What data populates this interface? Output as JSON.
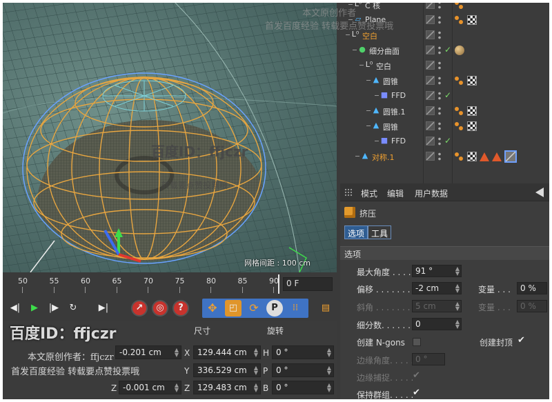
{
  "viewport": {
    "grid_readout": "网格间距 : 100 cm"
  },
  "objects": [
    {
      "name": "C 核",
      "color": "#dddddd",
      "tags": [
        "phong"
      ]
    },
    {
      "name": "Plane",
      "color": "#dddddd",
      "tags": [
        "phong",
        "checker"
      ]
    },
    {
      "name": "空白",
      "color": "#f0a030",
      "tags": []
    },
    {
      "name": "细分曲面",
      "color": "#dddddd",
      "tags": [
        "material"
      ],
      "check": "✓"
    },
    {
      "name": "空白",
      "color": "#dddddd",
      "tags": []
    },
    {
      "name": "圆锥",
      "color": "#dddddd",
      "tags": [
        "phong",
        "checker"
      ]
    },
    {
      "name": "FFD",
      "color": "#dddddd",
      "tags": [],
      "check": "✓"
    },
    {
      "name": "圆锥.1",
      "color": "#dddddd",
      "tags": [
        "phong",
        "checker"
      ]
    },
    {
      "name": "圆锥",
      "color": "#dddddd",
      "tags": [
        "phong",
        "checker"
      ]
    },
    {
      "name": "FFD",
      "color": "#dddddd",
      "tags": [],
      "check": "✓"
    },
    {
      "name": "对称.1",
      "color": "#f0a030",
      "tags": [
        "phong",
        "checker",
        "tri",
        "tri",
        "selected"
      ]
    }
  ],
  "attributes": {
    "menu": [
      "模式",
      "编辑",
      "用户数据"
    ],
    "object_name": "挤压",
    "tabs": [
      "选项",
      "工具"
    ],
    "section": "选项",
    "params": {
      "max_angle": {
        "label": "最大角度 . . . . . .",
        "value": "91 °"
      },
      "offset": {
        "label": "偏移 . . . . . . . .",
        "value": "-2 cm"
      },
      "bevel": {
        "label": "斜角 . . . . . . . .",
        "value": "5 cm"
      },
      "subdiv": {
        "label": "细分数. . . . . . .",
        "value": "0"
      },
      "create_ngons": {
        "label": "创建 N-gons"
      },
      "create_caps": {
        "label": "创建封顶"
      },
      "edge_angle": {
        "label": "边缘角度. . . . .",
        "value": "0 °"
      },
      "edge_snap": {
        "label": "边缘捕捉. . . . ."
      },
      "preserve_groups": {
        "label": "保持群组. . . . ."
      },
      "var1": {
        "label": "变量 . . .",
        "value": "0 %"
      },
      "var2": {
        "label": "变量 . . .",
        "value": "0 %"
      }
    }
  },
  "timeline": {
    "ticks": [
      "50",
      "55",
      "60",
      "65",
      "70",
      "75",
      "80",
      "85",
      "90"
    ],
    "current_frame": "0 F"
  },
  "coords": {
    "headers": {
      "size": "尺寸",
      "rotation": "旋转"
    },
    "position": [
      "-0.201 cm",
      "-0.001 cm"
    ],
    "size": {
      "x": "129.444 cm",
      "y": "336.529 cm",
      "z": "129.483 cm"
    },
    "rotation": {
      "h": "0 °",
      "p": "0 °",
      "b": "0 °"
    },
    "axes": {
      "x": "X",
      "y": "Y",
      "z": "Z",
      "h": "H",
      "p": "P",
      "b": "B"
    }
  },
  "watermarks": {
    "top_line1": "本文原创作者",
    "top_line2": "首发百度经验 转载要点赞投票哦",
    "mid_id": "百度ID：ffjczr",
    "mid_note": "转载要点赞投票哦",
    "bl_id": "百度ID：ffjczr",
    "bl_line1": "本文原创作者：ffjczr",
    "bl_line2": "首发百度经验  转载要点赞投票哦"
  }
}
